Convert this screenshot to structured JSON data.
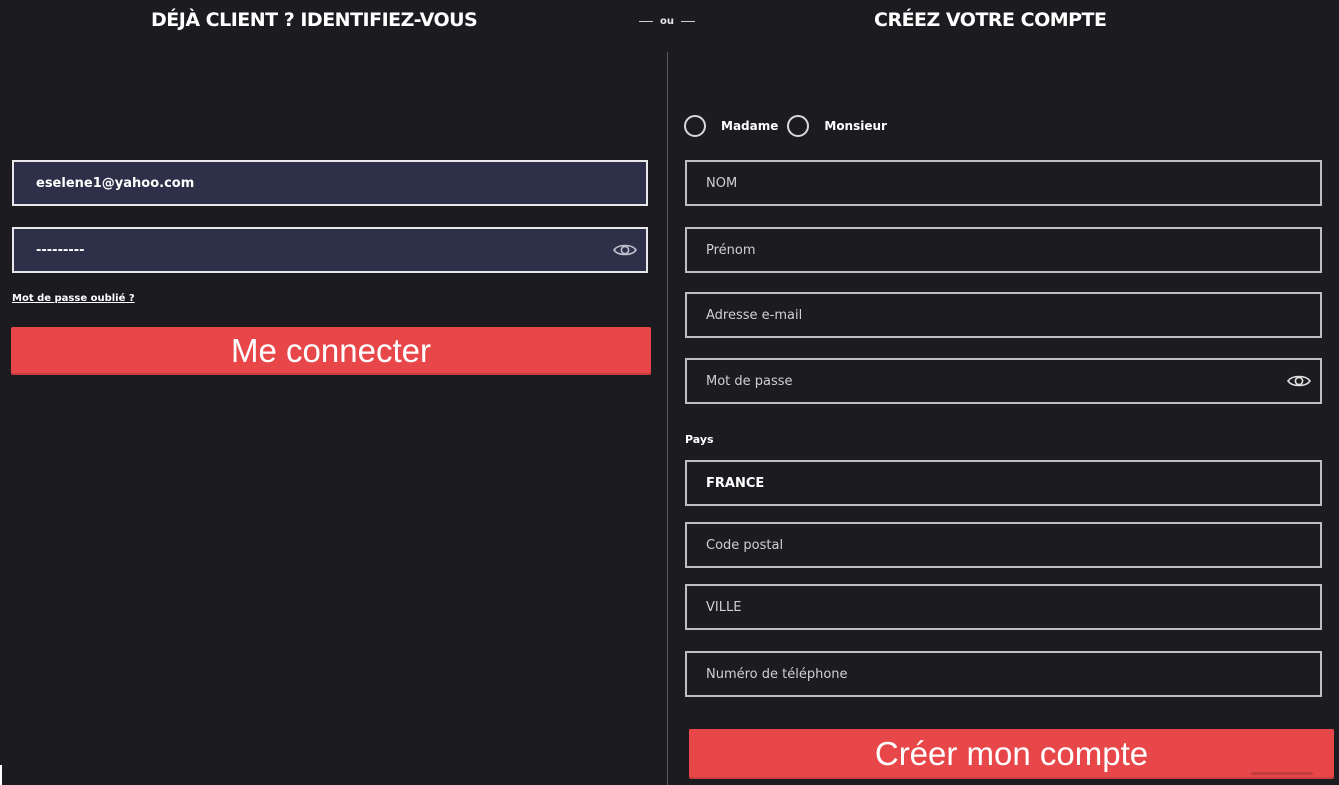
{
  "login": {
    "heading": "DÉJÀ CLIENT ? IDENTIFIEZ-VOUS",
    "email_value": "eselene1@yahoo.com",
    "password_value": "---------",
    "forgot_label": "Mot de passe oublié ?",
    "submit_label": "Me connecter"
  },
  "separator": {
    "label": "ou"
  },
  "register": {
    "heading": "CRÉEZ VOTRE COMPTE",
    "civility": {
      "options": [
        "Madame",
        "Monsieur"
      ]
    },
    "fields": {
      "lastname_placeholder": "NOM",
      "firstname_placeholder": "Prénom",
      "email_placeholder": "Adresse e-mail",
      "password_placeholder": "Mot de passe",
      "country_label": "Pays",
      "country_value": "FRANCE",
      "postal_placeholder": "Code postal",
      "city_placeholder": "VILLE",
      "phone_placeholder": "Numéro de téléphone"
    },
    "submit_label": "Créer mon compte"
  },
  "colors": {
    "background": "#1c1b1f",
    "accent_red": "#e84749",
    "login_field_bg": "#2e2f48"
  },
  "icons": {
    "password_toggle": "eye-icon"
  }
}
